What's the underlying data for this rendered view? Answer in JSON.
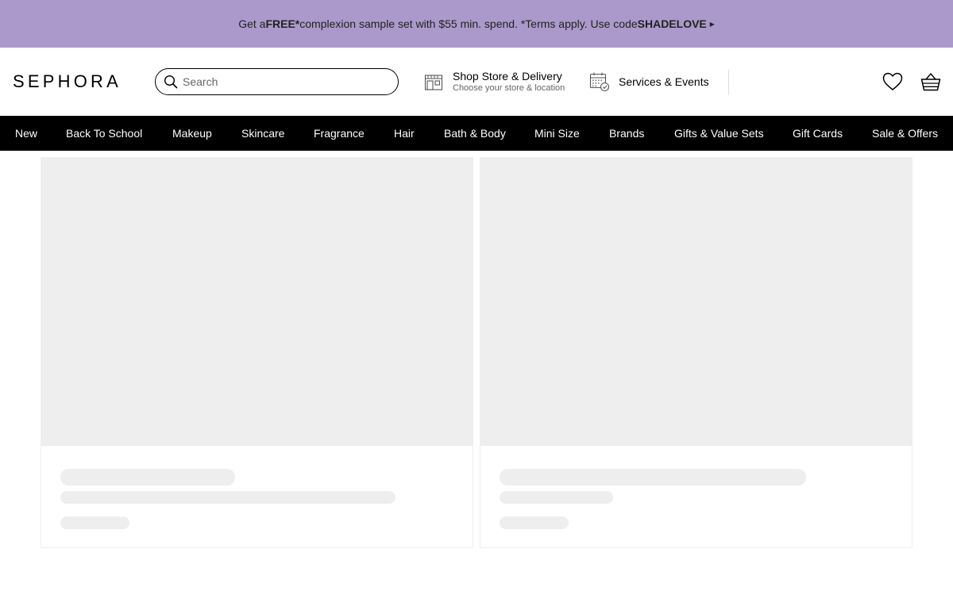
{
  "promo": {
    "part1": "Get a ",
    "free": "FREE*",
    "part2": " complexion sample set with $55 min. spend. *Terms apply. Use code ",
    "code": "SHADELOVE",
    "arrow": "▸"
  },
  "header": {
    "logo": "SEPHORA",
    "search_placeholder": "Search",
    "store_title": "Shop Store & Delivery",
    "store_subtitle": "Choose your store & location",
    "services_label": "Services & Events"
  },
  "nav": {
    "items": [
      "New",
      "Back To School",
      "Makeup",
      "Skincare",
      "Fragrance",
      "Hair",
      "Bath & Body",
      "Mini Size",
      "Brands",
      "Gifts & Value Sets",
      "Gift Cards",
      "Sale & Offers"
    ]
  },
  "colors": {
    "banner": "#ab99cb",
    "nav_background": "#000000",
    "skeleton": "#eeeeee"
  }
}
